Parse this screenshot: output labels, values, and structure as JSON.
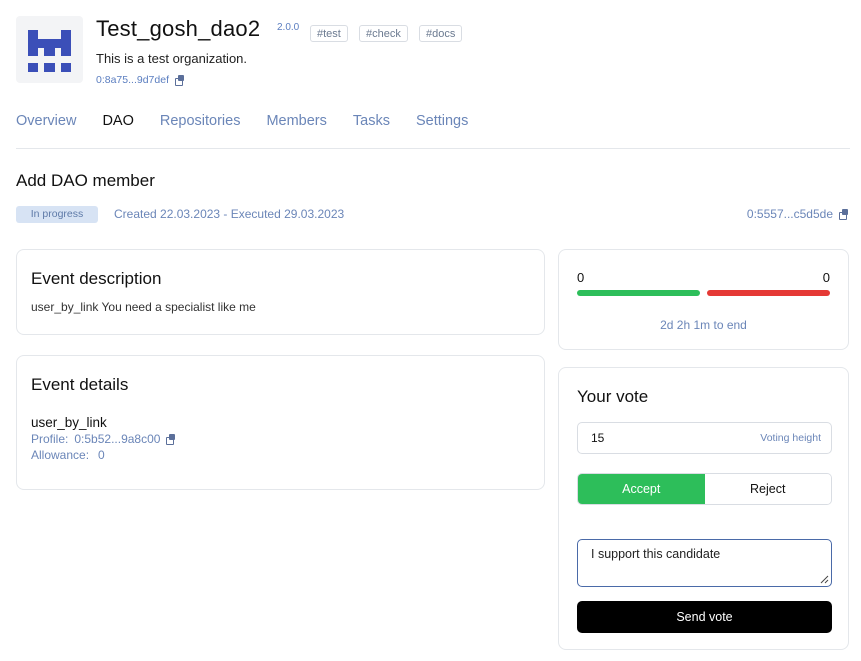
{
  "dao": {
    "name": "Test_gosh_dao2",
    "version": "2.0.0",
    "tags": [
      "#test",
      "#check",
      "#docs"
    ],
    "description": "This is a test organization.",
    "address": "0:8a75...9d7def"
  },
  "tabs": [
    {
      "label": "Overview"
    },
    {
      "label": "DAO",
      "active": true
    },
    {
      "label": "Repositories"
    },
    {
      "label": "Members"
    },
    {
      "label": "Tasks"
    },
    {
      "label": "Settings"
    }
  ],
  "event": {
    "title": "Add DAO member",
    "status": "In progress",
    "dates": "Created 22.03.2023 - Executed 29.03.2023",
    "address": "0:5557...c5d5de"
  },
  "description_card": {
    "title": "Event description",
    "text": "user_by_link You need a specialist like me"
  },
  "details_card": {
    "title": "Event details",
    "name": "user_by_link",
    "profile_label": "Profile:",
    "profile_value": "0:5b52...9a8c00",
    "allowance_label": "Allowance:",
    "allowance_value": "0"
  },
  "results": {
    "yes": "0",
    "no": "0",
    "time_left": "2d 2h 1m to end",
    "colors": {
      "yes": "#2dbe5a",
      "no": "#e53935"
    }
  },
  "vote": {
    "title": "Your vote",
    "height_value": "15",
    "height_hint": "Voting height",
    "accept_label": "Accept",
    "reject_label": "Reject",
    "selected": "Accept",
    "comment": "I support this candidate",
    "send_label": "Send vote"
  }
}
